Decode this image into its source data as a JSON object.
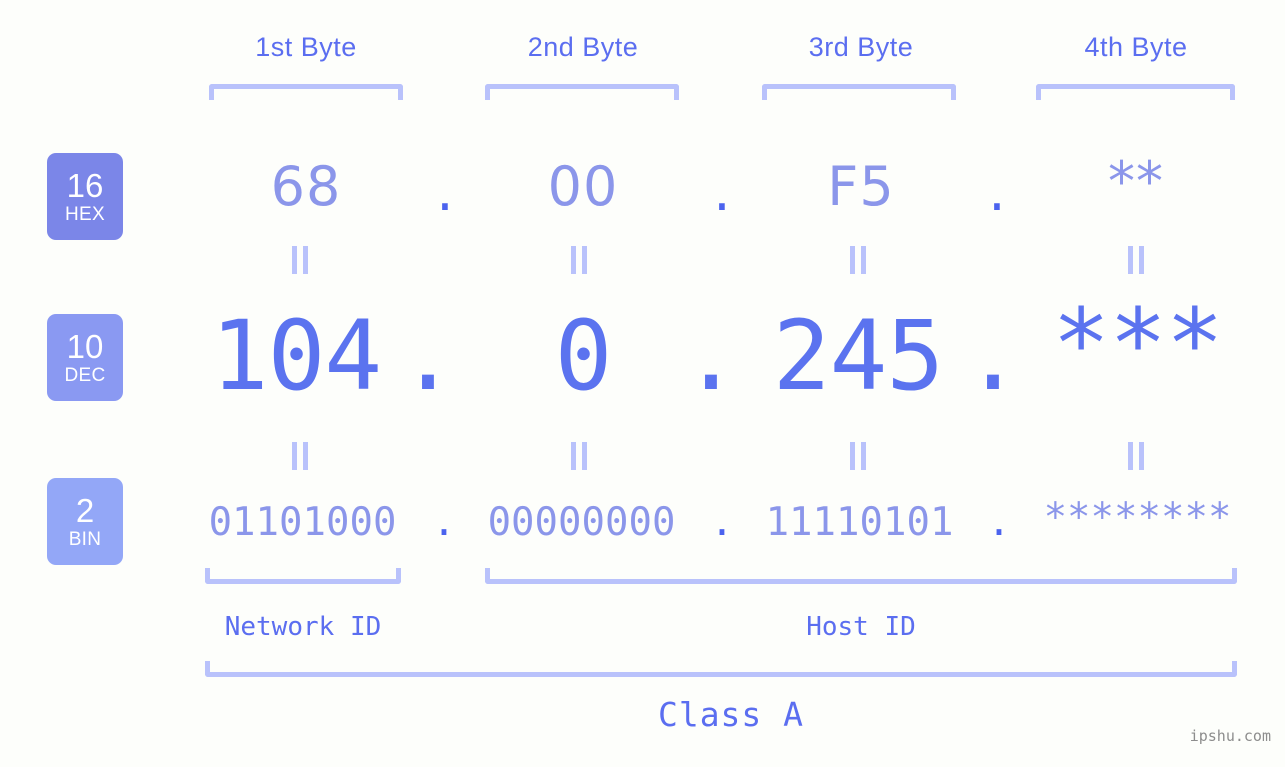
{
  "meta": {
    "background_color": "#fdfefb",
    "accent_strong": "#5b73ef",
    "accent_light": "#8b96ea",
    "bracket_color": "#b9c2fb",
    "watermark": "ipshu.com"
  },
  "byte_headers": [
    {
      "label": "1st Byte"
    },
    {
      "label": "2nd Byte"
    },
    {
      "label": "3rd Byte"
    },
    {
      "label": "4th Byte"
    }
  ],
  "bases": [
    {
      "num": "16",
      "abbr": "HEX",
      "color": "#7b86e8"
    },
    {
      "num": "10",
      "abbr": "DEC",
      "color": "#8a99f2"
    },
    {
      "num": "2",
      "abbr": "BIN",
      "color": "#93a7f7"
    }
  ],
  "rows": {
    "hex": {
      "values": [
        "68",
        "00",
        "F5",
        "**"
      ],
      "separator": "."
    },
    "dec": {
      "values": [
        "104",
        "0",
        "245",
        "***"
      ],
      "separator": "."
    },
    "bin": {
      "values": [
        "01101000",
        "00000000",
        "11110101",
        "********"
      ],
      "separator": "."
    }
  },
  "equals_symbol": "=",
  "segments": {
    "network_id": "Network ID",
    "host_id": "Host ID",
    "class": "Class A"
  }
}
